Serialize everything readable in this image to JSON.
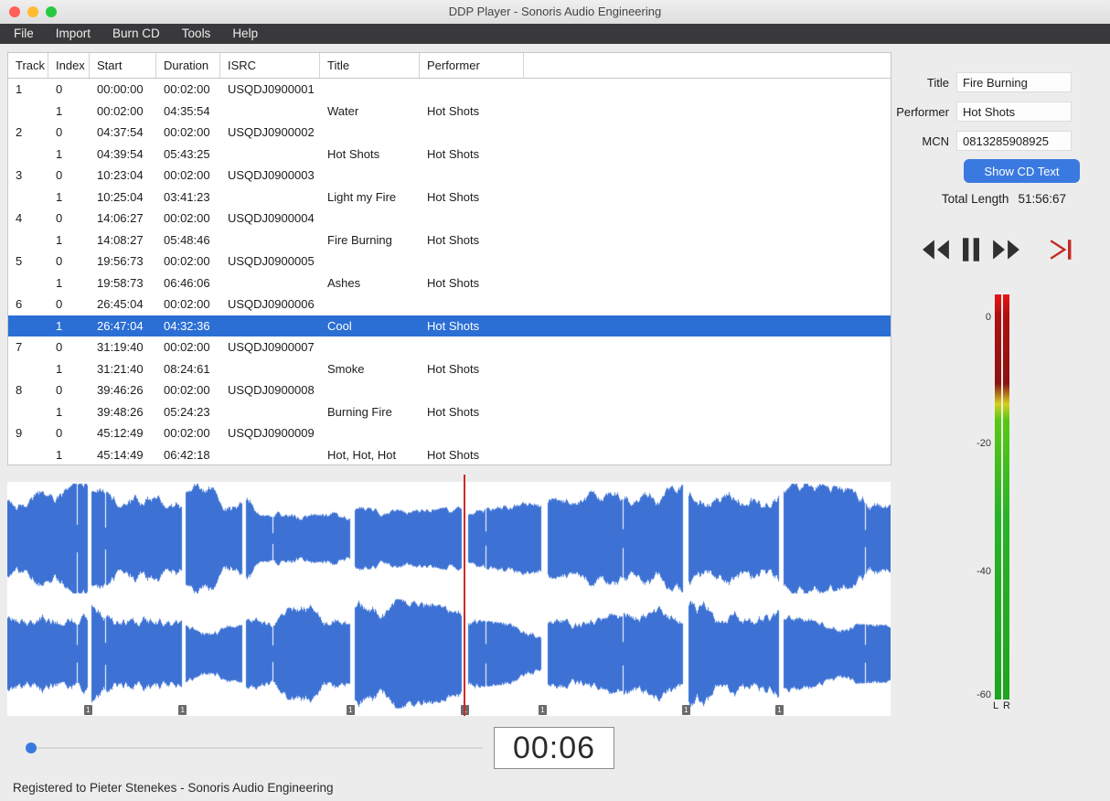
{
  "window": {
    "title": "DDP Player - Sonoris Audio Engineering"
  },
  "menu": {
    "items": [
      "File",
      "Import",
      "Burn CD",
      "Tools",
      "Help"
    ]
  },
  "table": {
    "columns": [
      "Track",
      "Index",
      "Start",
      "Duration",
      "ISRC",
      "Title",
      "Performer"
    ],
    "rows": [
      {
        "track": "1",
        "index": "0",
        "start": "00:00:00",
        "duration": "00:02:00",
        "isrc": "USQDJ0900001",
        "title": "",
        "performer": "",
        "selected": false
      },
      {
        "track": "",
        "index": "1",
        "start": "00:02:00",
        "duration": "04:35:54",
        "isrc": "",
        "title": "Water",
        "performer": "Hot Shots",
        "selected": false
      },
      {
        "track": "2",
        "index": "0",
        "start": "04:37:54",
        "duration": "00:02:00",
        "isrc": "USQDJ0900002",
        "title": "",
        "performer": "",
        "selected": false
      },
      {
        "track": "",
        "index": "1",
        "start": "04:39:54",
        "duration": "05:43:25",
        "isrc": "",
        "title": "Hot Shots",
        "performer": "Hot Shots",
        "selected": false
      },
      {
        "track": "3",
        "index": "0",
        "start": "10:23:04",
        "duration": "00:02:00",
        "isrc": "USQDJ0900003",
        "title": "",
        "performer": "",
        "selected": false
      },
      {
        "track": "",
        "index": "1",
        "start": "10:25:04",
        "duration": "03:41:23",
        "isrc": "",
        "title": "Light my Fire",
        "performer": "Hot Shots",
        "selected": false
      },
      {
        "track": "4",
        "index": "0",
        "start": "14:06:27",
        "duration": "00:02:00",
        "isrc": "USQDJ0900004",
        "title": "",
        "performer": "",
        "selected": false
      },
      {
        "track": "",
        "index": "1",
        "start": "14:08:27",
        "duration": "05:48:46",
        "isrc": "",
        "title": "Fire Burning",
        "performer": "Hot Shots",
        "selected": false
      },
      {
        "track": "5",
        "index": "0",
        "start": "19:56:73",
        "duration": "00:02:00",
        "isrc": "USQDJ0900005",
        "title": "",
        "performer": "",
        "selected": false
      },
      {
        "track": "",
        "index": "1",
        "start": "19:58:73",
        "duration": "06:46:06",
        "isrc": "",
        "title": "Ashes",
        "performer": "Hot Shots",
        "selected": false
      },
      {
        "track": "6",
        "index": "0",
        "start": "26:45:04",
        "duration": "00:02:00",
        "isrc": "USQDJ0900006",
        "title": "",
        "performer": "",
        "selected": false
      },
      {
        "track": "",
        "index": "1",
        "start": "26:47:04",
        "duration": "04:32:36",
        "isrc": "",
        "title": "Cool",
        "performer": "Hot Shots",
        "selected": true
      },
      {
        "track": "7",
        "index": "0",
        "start": "31:19:40",
        "duration": "00:02:00",
        "isrc": "USQDJ0900007",
        "title": "",
        "performer": "",
        "selected": false
      },
      {
        "track": "",
        "index": "1",
        "start": "31:21:40",
        "duration": "08:24:61",
        "isrc": "",
        "title": "Smoke",
        "performer": "Hot Shots",
        "selected": false
      },
      {
        "track": "8",
        "index": "0",
        "start": "39:46:26",
        "duration": "00:02:00",
        "isrc": "USQDJ0900008",
        "title": "",
        "performer": "",
        "selected": false
      },
      {
        "track": "",
        "index": "1",
        "start": "39:48:26",
        "duration": "05:24:23",
        "isrc": "",
        "title": "Burning Fire",
        "performer": "Hot Shots",
        "selected": false
      },
      {
        "track": "9",
        "index": "0",
        "start": "45:12:49",
        "duration": "00:02:00",
        "isrc": "USQDJ0900009",
        "title": "",
        "performer": "",
        "selected": false
      },
      {
        "track": "",
        "index": "1",
        "start": "45:14:49",
        "duration": "06:42:18",
        "isrc": "",
        "title": "Hot, Hot, Hot",
        "performer": "Hot Shots",
        "selected": false
      }
    ]
  },
  "details": {
    "title_label": "Title",
    "title_value": "Fire Burning",
    "performer_label": "Performer",
    "performer_value": "Hot Shots",
    "mcn_label": "MCN",
    "mcn_value": "0813285908925",
    "show_cd_text_label": "Show CD Text",
    "total_length_label": "Total Length",
    "total_length_value": "51:56:67"
  },
  "transport": {
    "buttons": [
      "rewind-icon",
      "pause-icon",
      "fast-forward-icon",
      "play-to-end-icon"
    ]
  },
  "meter": {
    "scale_labels": [
      "0",
      "-20",
      "-40",
      "-60"
    ],
    "channel_labels": [
      "L",
      "R"
    ]
  },
  "player": {
    "time_display": "00:06",
    "slider_fraction": 0.012
  },
  "waveform": {
    "color": "#3d72d4",
    "playhead_color": "#cc2a2a",
    "playhead": 0.5166,
    "flag_label": "1",
    "flags": [
      0.091,
      0.198,
      0.388,
      0.5176,
      0.6056,
      0.768,
      0.8737
    ],
    "segments": [
      {
        "start": 0.0,
        "end": 0.0915
      },
      {
        "start": 0.0955,
        "end": 0.198
      },
      {
        "start": 0.202,
        "end": 0.2665
      },
      {
        "start": 0.2705,
        "end": 0.388
      },
      {
        "start": 0.393,
        "end": 0.515
      },
      {
        "start": 0.522,
        "end": 0.605
      },
      {
        "start": 0.612,
        "end": 0.7645
      },
      {
        "start": 0.771,
        "end": 0.8735
      },
      {
        "start": 0.879,
        "end": 1.0
      }
    ]
  },
  "status": {
    "text": "Registered to Pieter Stenekes - Sonoris Audio Engineering"
  }
}
